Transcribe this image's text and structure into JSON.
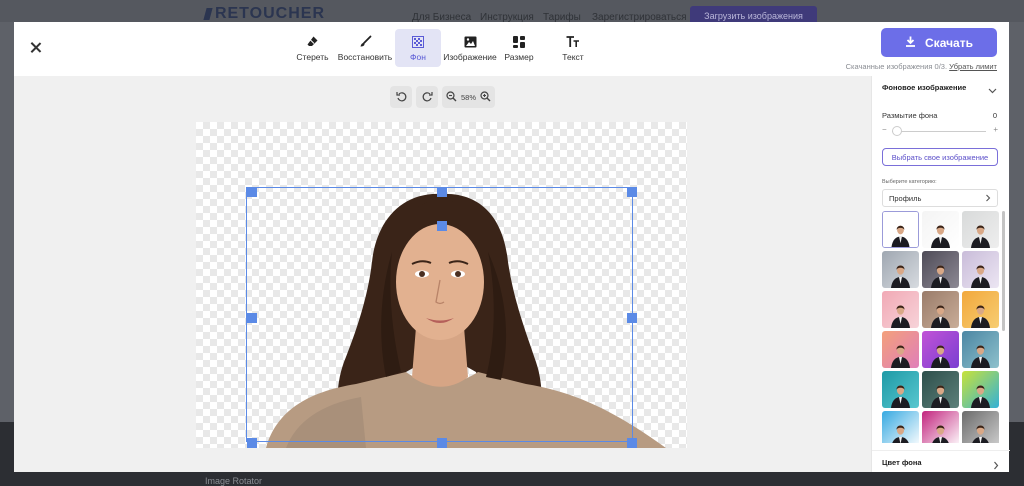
{
  "background_site": {
    "logo": "RETOUCHER",
    "nav": [
      "Для Бизнеса",
      "Инструкция",
      "Тарифы",
      "Зарегистрироваться"
    ],
    "upload_button": "Загрузить изображения",
    "footer_link": "Image Rotator"
  },
  "toolbar": {
    "tools": [
      {
        "label": "Стереть",
        "icon": "eraser-icon"
      },
      {
        "label": "Восстановить",
        "icon": "brush-icon"
      },
      {
        "label": "Фон",
        "icon": "checker-icon",
        "active": true
      },
      {
        "label": "Изображение",
        "icon": "image-icon"
      },
      {
        "label": "Размер",
        "icon": "layout-icon"
      },
      {
        "label": "Текст",
        "icon": "text-icon"
      }
    ],
    "download_label": "Скачать",
    "download_note": "Скачанные изображения 0/3.",
    "download_link": "Убрать лимит"
  },
  "zoom": {
    "value": "58%"
  },
  "panel": {
    "section_title": "Фоновое изображение",
    "blur_label": "Размытие фона",
    "blur_value": "0",
    "minus": "−",
    "plus": "+",
    "choose_button": "Выбрать свое изображение",
    "category_label": "Выберите категорию:",
    "category_value": "Профиль",
    "thumbnails": [
      {
        "bg": "#ffffff",
        "bg2": "#ffffff"
      },
      {
        "bg": "#f4f4f4",
        "bg2": "#ffffff"
      },
      {
        "bg": "#d8dada",
        "bg2": "#eeeeee"
      },
      {
        "bg": "#9fa7b1",
        "bg2": "#d7dbe0"
      },
      {
        "bg": "#4e4b57",
        "bg2": "#8d8994"
      },
      {
        "bg": "#c9bcd9",
        "bg2": "#ece6f3"
      },
      {
        "bg": "#f1a9b5",
        "bg2": "#f7d3d9"
      },
      {
        "bg": "#9a7c6a",
        "bg2": "#c9ad98"
      },
      {
        "bg": "#f2a83c",
        "bg2": "#f7cd72"
      },
      {
        "bg": "#f3a07b",
        "bg2": "#e07fb9"
      },
      {
        "bg": "#c152d6",
        "bg2": "#7a3fd2"
      },
      {
        "bg": "#4b86a3",
        "bg2": "#8ec1cc"
      },
      {
        "bg": "#1e9aa6",
        "bg2": "#58c7cf"
      },
      {
        "bg": "#2d4f4b",
        "bg2": "#5d807a"
      },
      {
        "bg": "#c7e23a",
        "bg2": "#35b1d6"
      },
      {
        "bg": "#36a9e1",
        "bg2": "#ffffff"
      },
      {
        "bg": "#c2247e",
        "bg2": "#ffffff"
      },
      {
        "bg": "#6b6b6b",
        "bg2": "#cfcfcf"
      }
    ],
    "color_section": "Цвет фона"
  },
  "colors": {
    "accent": "#6c6ee8",
    "selection": "#5b8ae6"
  }
}
